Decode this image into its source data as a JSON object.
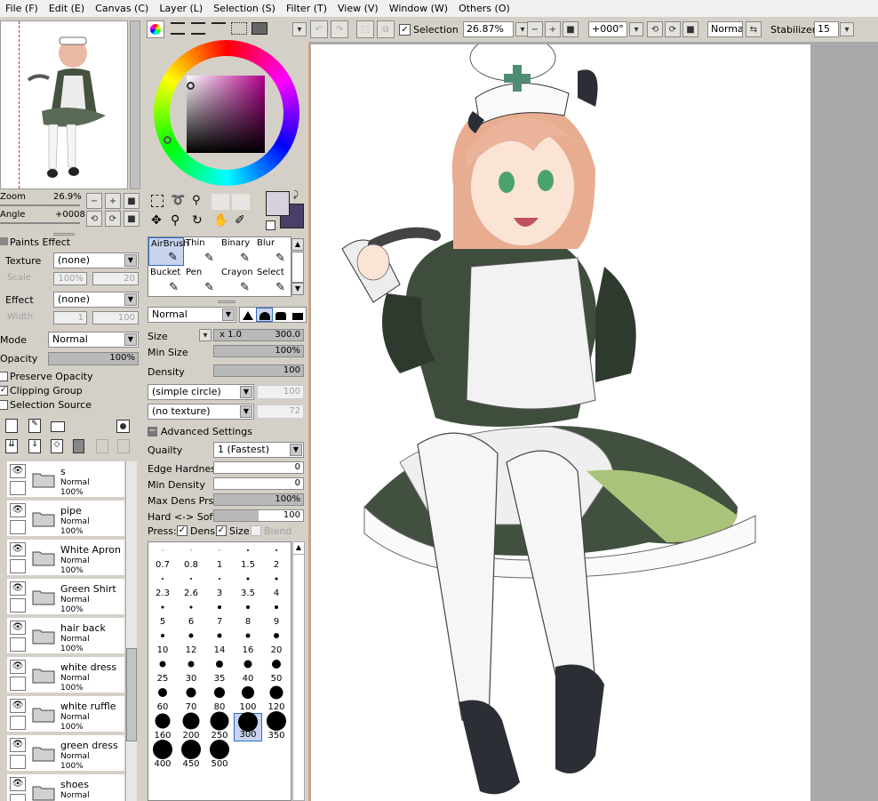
{
  "menu": [
    "File (F)",
    "Edit (E)",
    "Canvas (C)",
    "Layer (L)",
    "Selection (S)",
    "Filter (T)",
    "View (V)",
    "Window (W)",
    "Others (O)"
  ],
  "toolbar": {
    "selection_label": "Selection",
    "zoom": "26.87%",
    "angle": "+000°",
    "blend_mode": "Normal",
    "stabilizer_label": "Stabilizer",
    "stabilizer": "15"
  },
  "navigator": {
    "zoom_label": "Zoom",
    "zoom_value": "26.9%",
    "angle_label": "Angle",
    "angle_value": "+0008"
  },
  "paints_effect": {
    "title": "Paints Effect",
    "texture_label": "Texture",
    "texture_value": "(none)",
    "scale_label": "Scale",
    "scale_value": "100%",
    "scale_num": "20",
    "effect_label": "Effect",
    "effect_value": "(none)",
    "width_label": "Width",
    "width_value": "1",
    "width_num": "100"
  },
  "layer_props": {
    "mode_label": "Mode",
    "mode_value": "Normal",
    "opacity_label": "Opacity",
    "opacity_value": "100%",
    "opacity_level": 1.0,
    "preserve_opacity": "Preserve Opacity",
    "clipping_group": "Clipping Group",
    "selection_source": "Selection Source"
  },
  "layers": [
    {
      "name": "s",
      "mode": "Normal",
      "opacity": "100%"
    },
    {
      "name": "pipe",
      "mode": "Normal",
      "opacity": "100%"
    },
    {
      "name": "White Apron",
      "mode": "Normal",
      "opacity": "100%"
    },
    {
      "name": "Green Shirt",
      "mode": "Normal",
      "opacity": "100%"
    },
    {
      "name": "hair back",
      "mode": "Normal",
      "opacity": "100%"
    },
    {
      "name": "white dress",
      "mode": "Normal",
      "opacity": "100%"
    },
    {
      "name": "white ruffle",
      "mode": "Normal",
      "opacity": "100%"
    },
    {
      "name": "green dress",
      "mode": "Normal",
      "opacity": "100%"
    },
    {
      "name": "shoes",
      "mode": "Normal",
      "opacity": ""
    }
  ],
  "tools": [
    {
      "name": "AirBrush",
      "selected": true
    },
    {
      "name": "Thin",
      "selected": false
    },
    {
      "name": "Binary",
      "selected": false
    },
    {
      "name": "Blur",
      "selected": false
    },
    {
      "name": "Bucket",
      "selected": false
    },
    {
      "name": "Pen",
      "selected": false
    },
    {
      "name": "Crayon",
      "selected": false
    },
    {
      "name": "Select",
      "selected": false
    }
  ],
  "brush": {
    "blend": "Normal",
    "size_label": "Size",
    "size_mult": "x 1.0",
    "size_value": "300.0",
    "size_level": 1.0,
    "minsize_label": "Min Size",
    "minsize_value": "100%",
    "minsize_level": 1.0,
    "density_label": "Density",
    "density_value": "100",
    "density_level": 1.0,
    "shape": "(simple circle)",
    "shape_num": "100",
    "texture": "(no texture)",
    "texture_num": "72",
    "adv_title": "Advanced Settings",
    "quality_label": "Quailty",
    "quality_value": "1 (Fastest)",
    "edge_label": "Edge Hardness",
    "edge_value": "0",
    "edge_level": 0,
    "mindens_label": "Min Density",
    "mindens_value": "0",
    "mindens_level": 0,
    "maxdens_label": "Max Dens Prs.",
    "maxdens_value": "100%",
    "maxdens_level": 1.0,
    "hardsoft_label": "Hard <-> Soft",
    "hardsoft_value": "100",
    "hardsoft_level": 0.5,
    "press_label": "Press:",
    "dens_label": "Dens",
    "size_chk_label": "Size",
    "blend_label": "Blend"
  },
  "brush_sizes": [
    "0.7",
    "0.8",
    "1",
    "1.5",
    "2",
    "2.3",
    "2.6",
    "3",
    "3.5",
    "4",
    "5",
    "6",
    "7",
    "8",
    "9",
    "10",
    "12",
    "14",
    "16",
    "20",
    "25",
    "30",
    "35",
    "40",
    "50",
    "60",
    "70",
    "80",
    "100",
    "120",
    "160",
    "200",
    "250",
    "300",
    "350",
    "400",
    "450",
    "500"
  ],
  "selected_brush_size": "300",
  "colors": {
    "primary": "#d8d0dc",
    "secondary": "#4a3f66",
    "accent": "#316ac5"
  }
}
